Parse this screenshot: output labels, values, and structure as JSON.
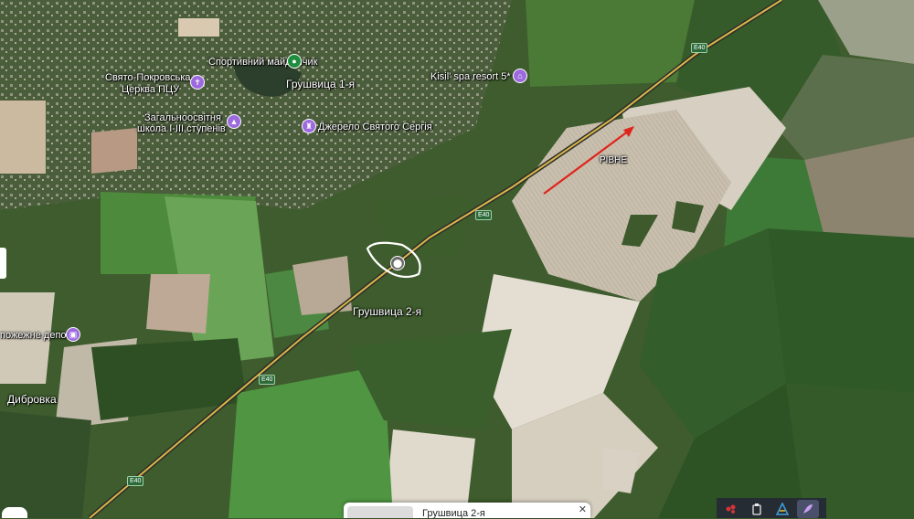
{
  "map": {
    "labels": {
      "sport_ground": "Спортивний майданчик",
      "church_1": "Свято-Покровська",
      "church_2": "Церква ПЦУ",
      "village_1": "Грушвица 1-я",
      "resort": "Kisil' spa resort 5*",
      "school_1": "Загальноосвітня",
      "school_2": "школа I-III ступенів",
      "spring": "Джерело Святого Сергія",
      "rivne": "РІВНЕ",
      "village_2": "Грушвица 2-я",
      "fire_depot": "пожежне депо",
      "dybrovka": "Дибровка"
    },
    "roads": [
      "E40",
      "E40",
      "E40",
      "E40"
    ],
    "icons": {
      "sport_pin": "green-circle-pin-icon",
      "church_pin": "church-cross-icon",
      "resort_pin": "hotel-bed-icon",
      "school_pin": "school-cap-icon",
      "spring_pin": "landmark-icon",
      "fire_pin": "fire-station-icon",
      "place_pin": "location-pin-icon",
      "arrow": "red-arrow-annotation"
    },
    "colors": {
      "arrow": "#e0241b",
      "outline": "#ffffff",
      "road": "#d8b64a",
      "pin_green": "#1e8e3e",
      "pin_purple": "#9c6ade"
    }
  },
  "card": {
    "title": "Грушвица 2-я",
    "close": "✕"
  },
  "toolbar": {
    "icons": [
      "puzzle-icon",
      "clipboard-icon",
      "vpn-icon",
      "feather-icon"
    ]
  }
}
